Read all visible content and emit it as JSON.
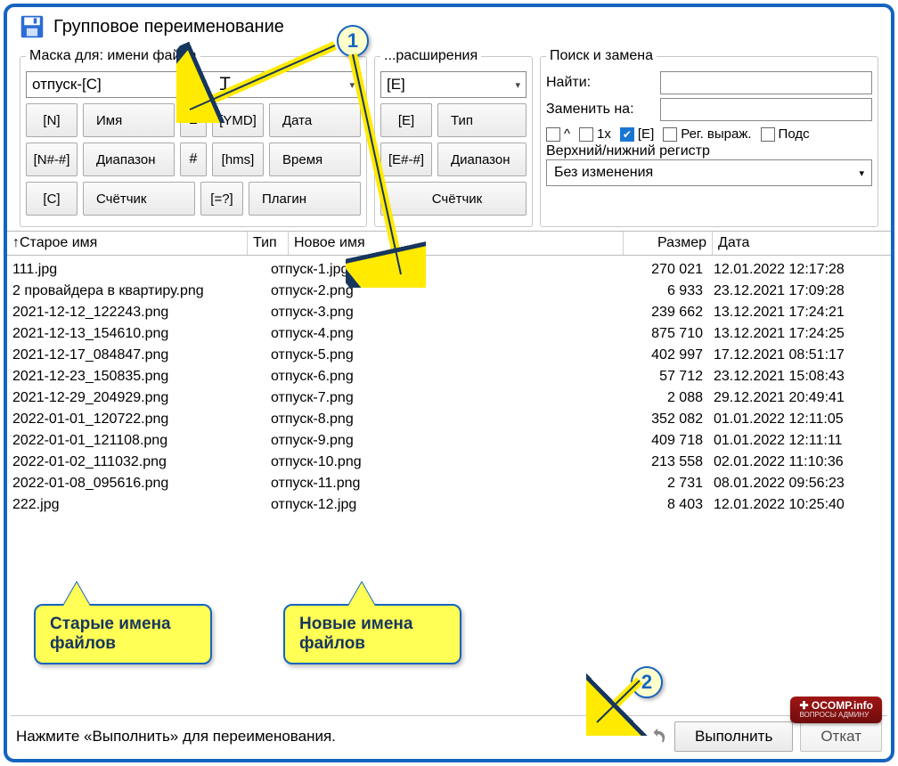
{
  "window": {
    "title": "Групповое переименование"
  },
  "panel_filename": {
    "legend": "Маска для: имени файла",
    "value": "отпуск-[C]",
    "buttons": {
      "n_tag": "[N]",
      "n_label": "Имя",
      "plus": "±",
      "ymd_tag": "[YMD]",
      "ymd_label": "Дата",
      "range_tag": "[N#-#]",
      "range_label": "Диапазон",
      "hash": "#",
      "hms_tag": "[hms]",
      "hms_label": "Время",
      "c_tag": "[C]",
      "c_label": "Счётчик",
      "plugin_tag": "[=?]",
      "plugin_label": "Плагин"
    }
  },
  "panel_ext": {
    "legend": "...расширения",
    "value": "[E]",
    "buttons": {
      "e_tag": "[E]",
      "e_label": "Тип",
      "erange_tag": "[E#-#]",
      "erange_label": "Диапазон",
      "ecount_label": "Счётчик"
    }
  },
  "panel_replace": {
    "legend": "Поиск и замена",
    "find_label": "Найти:",
    "replace_label": "Заменить на:",
    "checks": {
      "caret": "^",
      "once": "1x",
      "e": "[E]",
      "regex": "Рег. выраж.",
      "sub": "Подс"
    },
    "case_label": "Верхний/нижний регистр",
    "case_value": "Без изменения"
  },
  "table": {
    "headers": {
      "old": "Старое имя",
      "typ": "Тип",
      "new": "Новое имя",
      "size": "Размер",
      "date": "Дата"
    },
    "sort_indicator": "↑",
    "rows": [
      {
        "old": "111.jpg",
        "new": "отпуск-1.jpg",
        "size": "270 021",
        "date": "12.01.2022 12:17:28"
      },
      {
        "old": "2 провайдера в квартиру.png",
        "new": "отпуск-2.png",
        "size": "6 933",
        "date": "23.12.2021 17:09:28"
      },
      {
        "old": "2021-12-12_122243.png",
        "new": "отпуск-3.png",
        "size": "239 662",
        "date": "13.12.2021 17:24:21"
      },
      {
        "old": "2021-12-13_154610.png",
        "new": "отпуск-4.png",
        "size": "875 710",
        "date": "13.12.2021 17:24:25"
      },
      {
        "old": "2021-12-17_084847.png",
        "new": "отпуск-5.png",
        "size": "402 997",
        "date": "17.12.2021 08:51:17"
      },
      {
        "old": "2021-12-23_150835.png",
        "new": "отпуск-6.png",
        "size": "57 712",
        "date": "23.12.2021 15:08:43"
      },
      {
        "old": "2021-12-29_204929.png",
        "new": "отпуск-7.png",
        "size": "2 088",
        "date": "29.12.2021 20:49:41"
      },
      {
        "old": "2022-01-01_120722.png",
        "new": "отпуск-8.png",
        "size": "352 082",
        "date": "01.01.2022 12:11:05"
      },
      {
        "old": "2022-01-01_121108.png",
        "new": "отпуск-9.png",
        "size": "409 718",
        "date": "01.01.2022 12:11:11"
      },
      {
        "old": "2022-01-02_111032.png",
        "new": "отпуск-10.png",
        "size": "213 558",
        "date": "02.01.2022 11:10:36"
      },
      {
        "old": "2022-01-08_095616.png",
        "new": "отпуск-11.png",
        "size": "2 731",
        "date": "08.01.2022 09:56:23"
      },
      {
        "old": "222.jpg",
        "new": "отпуск-12.jpg",
        "size": "8 403",
        "date": "12.01.2022 10:25:40"
      }
    ]
  },
  "bottom": {
    "status": "Нажмите «Выполнить» для переименования.",
    "go": "Выполнить",
    "rollback": "Откат"
  },
  "annotations": {
    "bubble1": "1",
    "bubble2": "2",
    "callout_old": "Старые имена файлов",
    "callout_new": "Новые имена файлов",
    "badge_title": "OCOMP.info",
    "badge_sub": "ВОПРОСЫ АДМИНУ"
  }
}
